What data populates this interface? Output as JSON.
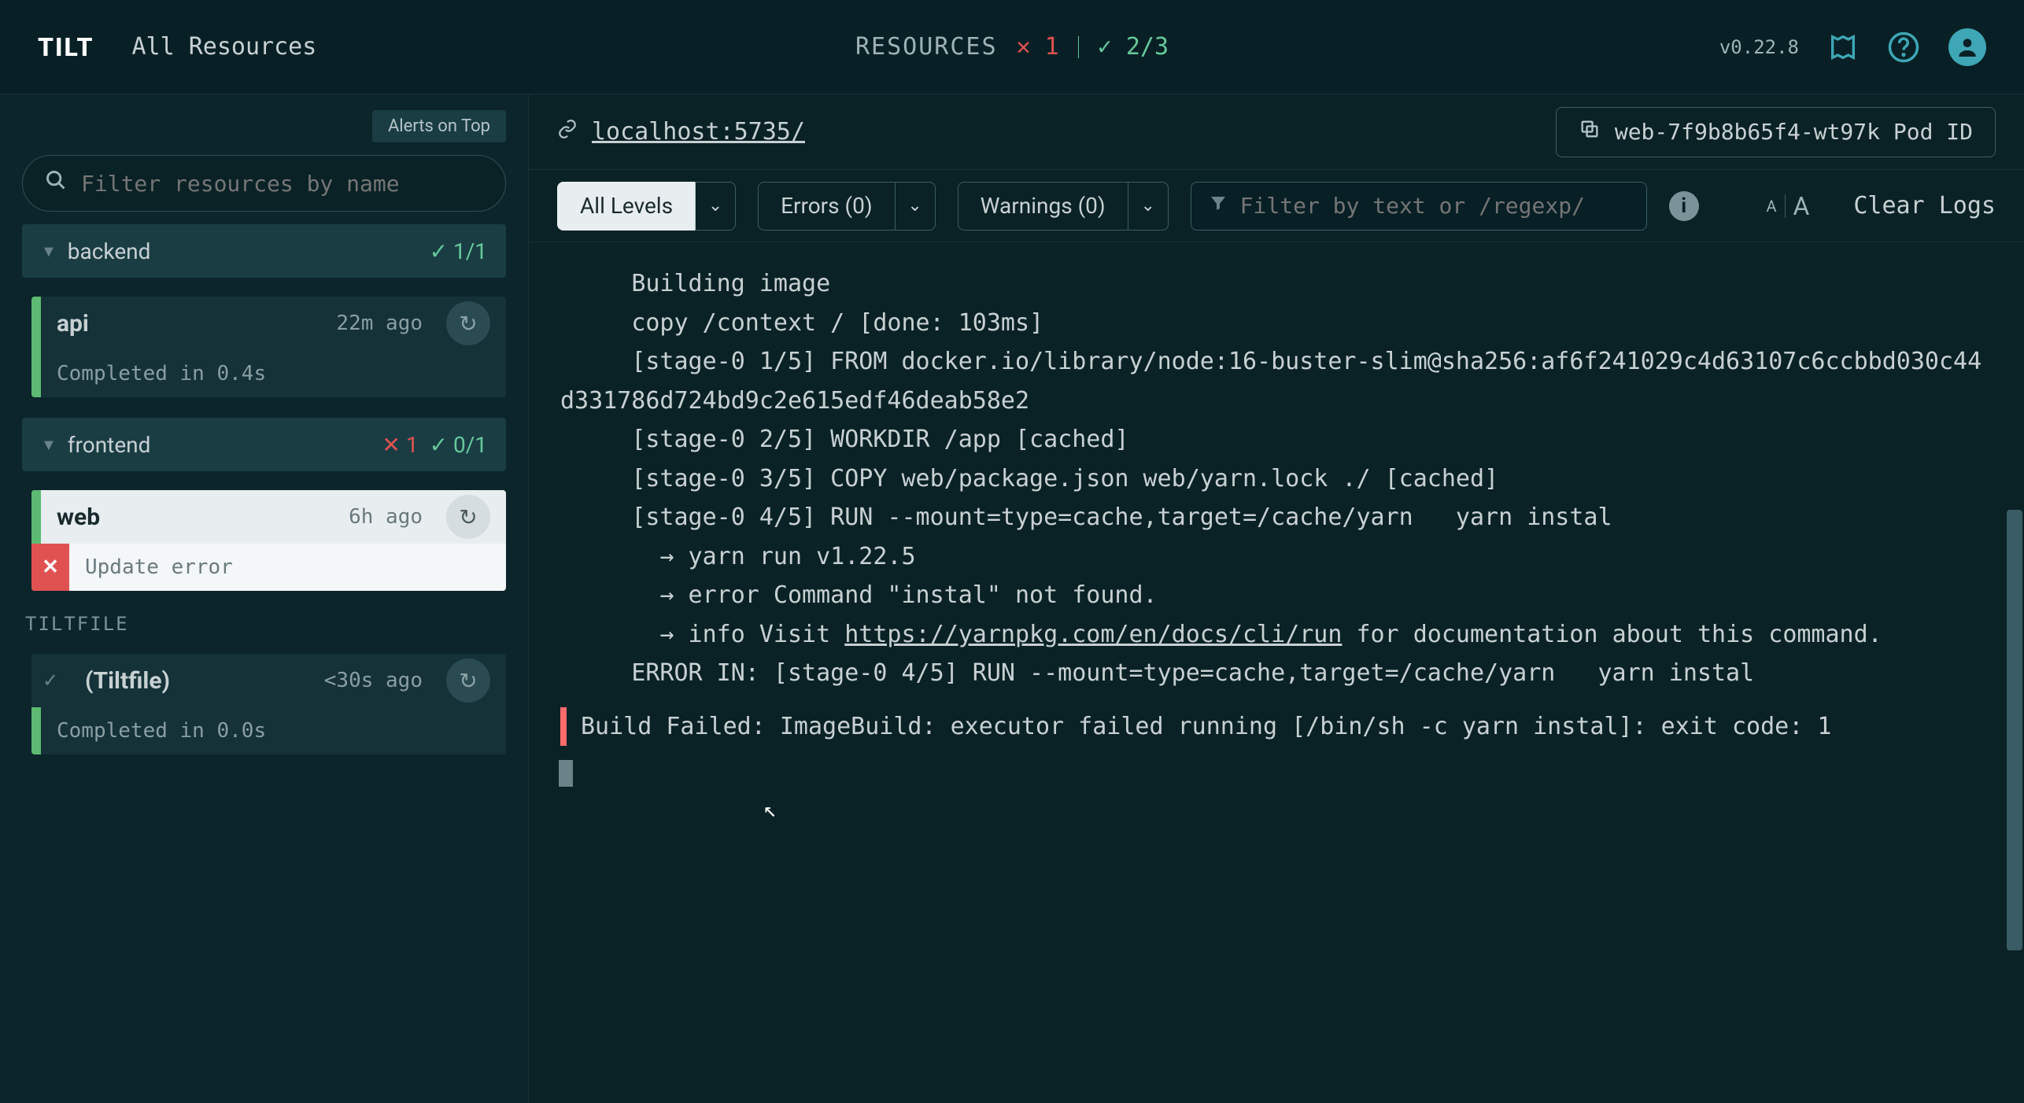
{
  "header": {
    "logo": "TILT",
    "title": "All Resources",
    "resources_label": "RESOURCES",
    "fail_count": "1",
    "pass_ratio": "2/3",
    "version": "v0.22.8"
  },
  "sidebar": {
    "alerts_toggle": "Alerts on Top",
    "filter_placeholder": "Filter resources by name",
    "groups": [
      {
        "name": "backend",
        "pass": "1/1",
        "items": [
          {
            "name": "api",
            "time": "22m ago",
            "status": "Completed in 0.4s",
            "state": "ok"
          }
        ]
      },
      {
        "name": "frontend",
        "fail": "1",
        "pass": "0/1",
        "items": [
          {
            "name": "web",
            "time": "6h ago",
            "status": "Update error",
            "state": "error",
            "selected": true
          }
        ]
      }
    ],
    "tiltfile_label": "TILTFILE",
    "tiltfile": {
      "name": "(Tiltfile)",
      "time": "<30s ago",
      "status": "Completed in 0.0s"
    }
  },
  "main": {
    "endpoint": "localhost:5735/",
    "pod_id": "web-7f9b8b65f4-wt97k Pod ID",
    "toolbar": {
      "all_levels": "All Levels",
      "errors": "Errors (0)",
      "warnings": "Warnings (0)",
      "filter_placeholder": "Filter by text or /regexp/",
      "clear_logs": "Clear Logs"
    },
    "log": {
      "l1": "     Building image",
      "l2": "     copy /context / [done: 103ms]",
      "l3": "     [stage-0 1/5] FROM docker.io/library/node:16-buster-slim@sha256:af6f241029c4d63107c6ccbbd030c44d331786d724bd9c2e615edf46deab58e2",
      "l4": "     [stage-0 2/5] WORKDIR /app [cached]",
      "l5": "     [stage-0 3/5] COPY web/package.json web/yarn.lock ./ [cached]",
      "l6": "     [stage-0 4/5] RUN --mount=type=cache,target=/cache/yarn   yarn instal",
      "l7": "       → yarn run v1.22.5",
      "l8": "       → error Command \"instal\" not found.",
      "l9a": "       → info Visit ",
      "l9link": "https://yarnpkg.com/en/docs/cli/run",
      "l9b": " for documentation about this command.",
      "l10": "",
      "l11": "     ERROR IN: [stage-0 4/5] RUN --mount=type=cache,target=/cache/yarn   yarn instal",
      "l12": "Build Failed: ImageBuild: executor failed running [/bin/sh -c yarn instal]: exit code: 1"
    }
  }
}
